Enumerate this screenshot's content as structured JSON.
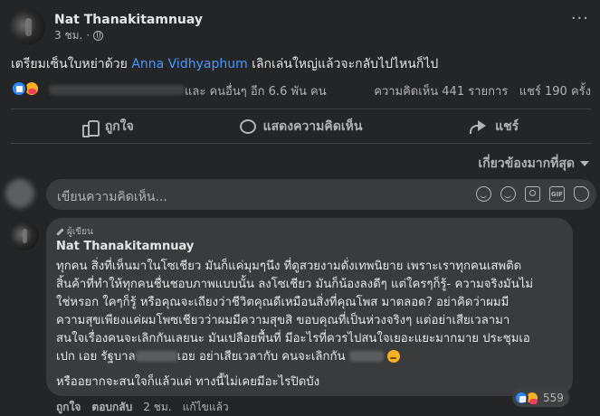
{
  "post": {
    "author": "Nat Thanakitamnuay",
    "time": "3 ชม.",
    "text_before": "เตรียมเซ็นใบหย่าด้วย",
    "text_link": "Anna Vidhyaphum",
    "text_after": "เลิกเล่นใหญ่แล้วจะกลับไปไหนก็ไป",
    "reactions_others": "และ คนอื่นๆ อีก 6.6 พัน คน",
    "comments_count": "ความคิดเห็น 441 รายการ",
    "shares_count": "แชร์ 190 ครั้ง"
  },
  "actions": {
    "like": "ถูกใจ",
    "comment": "แสดงความคิดเห็น",
    "share": "แชร์"
  },
  "sort_label": "เกี่ยวข้องมากที่สุด",
  "write_comment": {
    "placeholder": "เขียนความคิดเห็น..."
  },
  "comment": {
    "badge": "ผู้เขียน",
    "author": "Nat Thanakitamnuay",
    "lines": [
      "ทุกคน สิ่งที่เห็นมาในโซเชียว มันก็แค่มุมๆนึง ที่ดูสวยงามดั่งเทพนิยาย เพราะเราทุกคนเสพติด",
      "สิ้นค้าที่ทำให้ทุกคนชื่นชอบภาพแบบนั้น ลงโซเชียว มันก็น้องลงดีๆ แต่ใครๆก็รู้- ความจริงมันไม่",
      "ใช่หรอก ใคๆก็รู้ หรือคุณจะเถียงว่าชีวิตคุณดีเหมือนสิ่งที่คุณโพส มาตลอด? อย่าคิดว่าผมมี",
      "ความสุขเพียงแค่ผมโพซเชียวว่าผมมีความสุขสิ ขอบคุณที่เป็นห่วงจริงๆ แต่อย่าเสียเวลามา",
      "สนใจเรื่องคนจะเลิกกันเลยนะ มันเปลือยพื้นที่ มีอะไรที่ควรไปสนใจเยอะแยะมากมาย ประชุมเอ"
    ],
    "line6_a": "เปก เอย รัฐบาล",
    "line6_b": "เอย อย่าเสียเวลากับ คนจะเลิกกัน",
    "last_line": "หรืออยากจะสนใจก็แล้วแต่ ทางนี้ไม่เคยมีอะไรปิดบัง",
    "like": "ถูกใจ",
    "reply": "ตอบกลับ",
    "time": "2 ชม.",
    "edited": "แก้ไขแล้ว",
    "reaction_count": "559"
  }
}
